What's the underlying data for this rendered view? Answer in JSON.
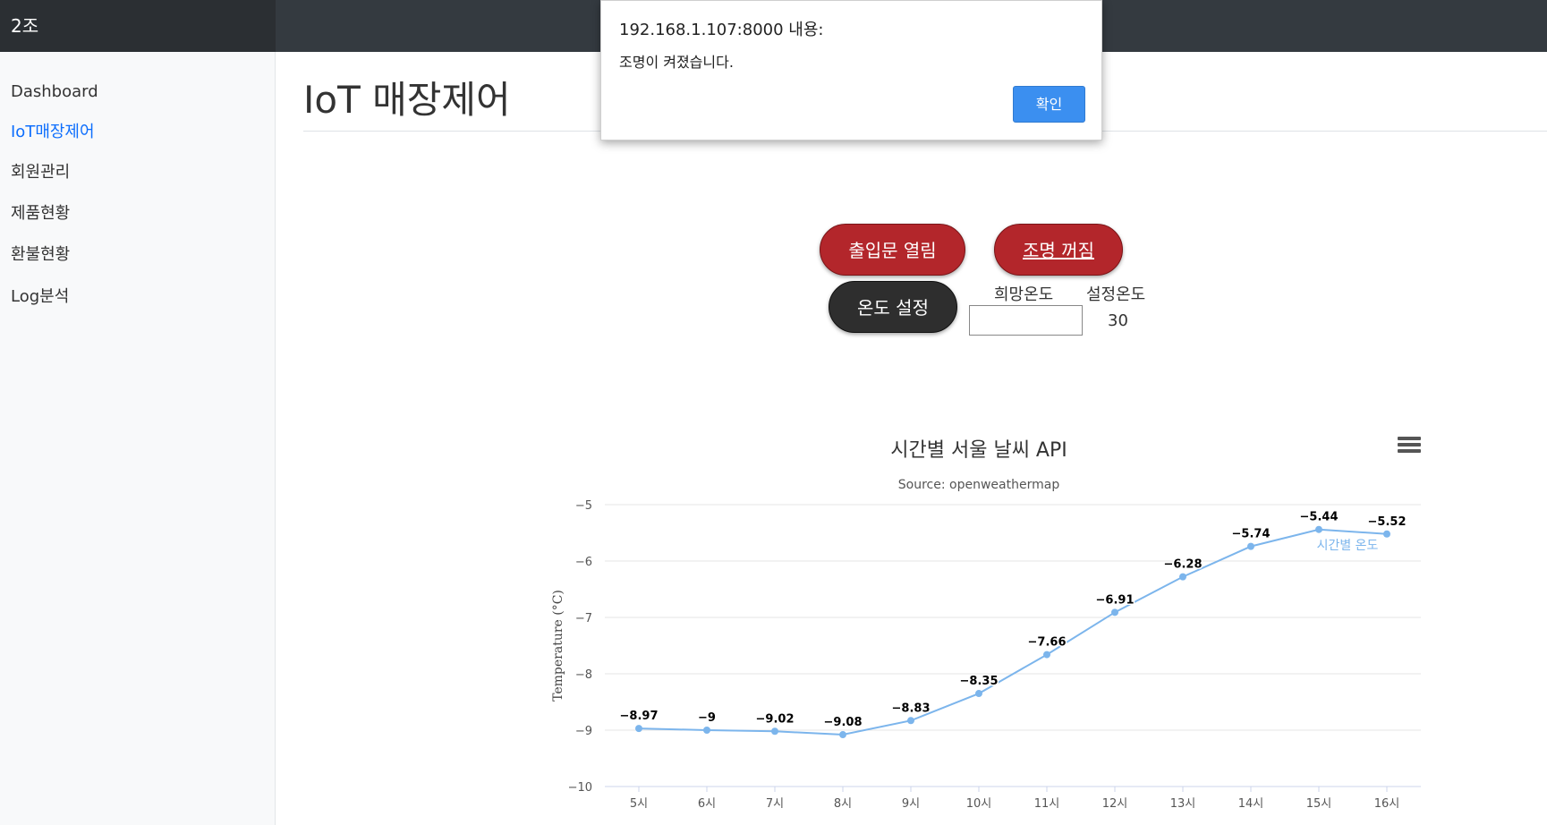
{
  "header": {
    "brand": "2조"
  },
  "sidebar": {
    "items": [
      {
        "label": "Dashboard"
      },
      {
        "label": "IoT매장제어"
      },
      {
        "label": "회원관리"
      },
      {
        "label": "제품현황"
      },
      {
        "label": "환불현황"
      },
      {
        "label": "Log분석"
      }
    ],
    "active_index": 1
  },
  "main": {
    "title": "IoT 매장제어",
    "controls": {
      "door_label": "출입문 열림",
      "light_label": "조명 꺼짐",
      "temp_button_label": "온도 설정",
      "desired_temp_label": "희망온도",
      "set_temp_label": "설정온도",
      "desired_temp_value": "",
      "set_temp_value": "30"
    }
  },
  "dialog": {
    "origin": "192.168.1.107:8000 내용:",
    "message": "조명이 켜졌습니다.",
    "ok_label": "확인"
  },
  "colors": {
    "accent": "#0d6efd",
    "red_button": "#b3262b",
    "dark_button": "#2e2e2e",
    "series": "#7cb5ec",
    "dialog_button": "#3b8ff0"
  },
  "chart_data": {
    "type": "line",
    "title": "시간별 서울 날씨 API",
    "subtitle": "Source: openweathermap",
    "xlabel": "",
    "ylabel": "Temperature (°C)",
    "categories": [
      "5시",
      "6시",
      "7시",
      "8시",
      "9시",
      "10시",
      "11시",
      "12시",
      "13시",
      "14시",
      "15시",
      "16시"
    ],
    "series": [
      {
        "name": "시간별 온도",
        "values": [
          -8.97,
          -9,
          -9.02,
          -9.08,
          -8.83,
          -8.35,
          -7.66,
          -6.91,
          -6.28,
          -5.74,
          -5.44,
          -5.52
        ]
      }
    ],
    "ylim": [
      -10,
      -5
    ],
    "yticks": [
      -5,
      -6,
      -7,
      -8,
      -9,
      -10
    ],
    "grid": true,
    "data_labels": true
  }
}
